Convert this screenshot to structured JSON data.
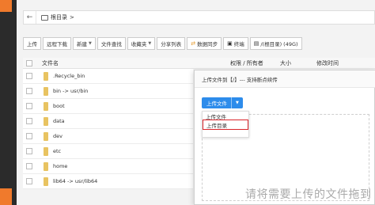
{
  "breadcrumb": {
    "back": "←",
    "root": "根目录",
    "sep": ">"
  },
  "toolbar": [
    {
      "label": "上传",
      "caret": false,
      "icon": ""
    },
    {
      "label": "远程下载",
      "caret": false,
      "icon": ""
    },
    {
      "label": "新建",
      "caret": true,
      "icon": ""
    },
    {
      "label": "文件查找",
      "caret": false,
      "icon": ""
    },
    {
      "label": "收藏夹",
      "caret": true,
      "icon": ""
    },
    {
      "label": "分享列表",
      "caret": false,
      "icon": ""
    },
    {
      "label": "数据同步",
      "caret": false,
      "icon": "sync-icon"
    },
    {
      "label": "终端",
      "caret": false,
      "icon": "terminal-icon"
    },
    {
      "label": "/(根目录) (49G)",
      "caret": false,
      "icon": "disk-icon"
    }
  ],
  "table": {
    "col_name": "文件名",
    "col_perm": "权限 / 所有者",
    "col_size": "大小",
    "col_mtime": "修改时间"
  },
  "files": [
    ".Recycle_bin",
    "bin -> usr/bin",
    "boot",
    "data",
    "dev",
    "etc",
    "home",
    "lib64 -> usr/lib64"
  ],
  "dialog": {
    "title": "上传文件到【/】--- 支持断点续传",
    "upload_button": "上传文件",
    "menu": [
      "上传文件",
      "上传目录"
    ],
    "dropzone_text": "请将需要上传的文件拖到"
  },
  "colors": {
    "accent_blue": "#2d8ceb",
    "highlight_red": "#d9242a",
    "folder": "#e8c361"
  }
}
